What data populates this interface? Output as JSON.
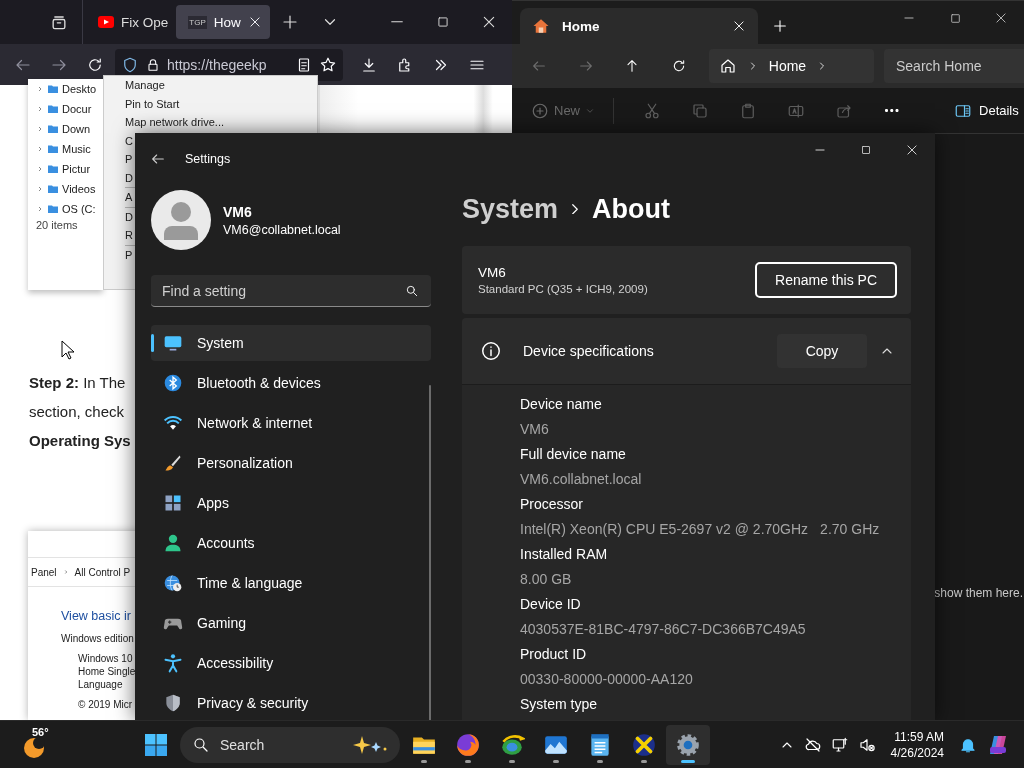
{
  "browser": {
    "tabs": [
      {
        "label": "Fix Ope",
        "selected": false
      },
      {
        "label": "How",
        "favicon_text": "TGP",
        "selected": true
      }
    ],
    "url": "https://thegeekp",
    "page": {
      "tree_items": [
        "Deskto",
        "Docur",
        "Down",
        "Music",
        "Pictur",
        "Videos",
        "OS (C:"
      ],
      "item_count": "20 items",
      "menu_items": [
        "Manage",
        "Pin to Start",
        "Map network drive...",
        "C",
        "P",
        "D",
        "A",
        "D",
        "R",
        "P"
      ],
      "step_lines": [
        {
          "text": "**Step 2:** In The",
          "bold": false
        },
        {
          "text": "section, check",
          "bold": false
        },
        {
          "text": "Operating Sys",
          "bold": true
        }
      ],
      "breadcrumb": [
        "Panel",
        "All Control P"
      ],
      "heading": "View basic ir",
      "edition_label": "Windows edition",
      "edition_lines": [
        "Windows 10",
        "Home Single",
        "Language"
      ],
      "copyright": "© 2019 Micr"
    }
  },
  "explorer": {
    "tabs": [
      {
        "label": "Home",
        "selected": true
      }
    ],
    "address": [
      "Home"
    ],
    "search": {
      "placeholder": "Search Home"
    },
    "new": {
      "label": "New",
      "disabled": true
    },
    "details": "Details",
    "content_text": "show them here."
  },
  "settings": {
    "title": "Settings",
    "user": {
      "name": "VM6",
      "email": "VM6@collabnet.local"
    },
    "search": {
      "placeholder": "Find a setting"
    },
    "nav": [
      {
        "label": "System",
        "kind": "system",
        "selected": true
      },
      {
        "label": "Bluetooth & devices",
        "kind": "bluetooth",
        "selected": false
      },
      {
        "label": "Network & internet",
        "kind": "network",
        "selected": false
      },
      {
        "label": "Personalization",
        "kind": "personalization",
        "selected": false
      },
      {
        "label": "Apps",
        "kind": "apps",
        "selected": false
      },
      {
        "label": "Accounts",
        "kind": "accounts",
        "selected": false
      },
      {
        "label": "Time & language",
        "kind": "time",
        "selected": false
      },
      {
        "label": "Gaming",
        "kind": "gaming",
        "selected": false
      },
      {
        "label": "Accessibility",
        "kind": "accessibility",
        "selected": false
      },
      {
        "label": "Privacy & security",
        "kind": "privacy",
        "selected": false
      }
    ],
    "breadcrumb": {
      "parent": "System",
      "current": "About"
    },
    "pc": {
      "name": "VM6",
      "model": "Standard PC (Q35 + ICH9, 2009)",
      "button": "Rename this PC"
    },
    "specs": {
      "title": "Device specifications",
      "copy": "Copy",
      "expanded": true,
      "items": [
        {
          "label": "Device name",
          "values": [
            "VM6"
          ]
        },
        {
          "label": "Full device name",
          "values": [
            "VM6.collabnet.local"
          ]
        },
        {
          "label": "Processor",
          "values": [
            "Intel(R) Xeon(R) CPU E5-2697 v2 @ 2.70GHz",
            "2.70 GHz"
          ]
        },
        {
          "label": "Installed RAM",
          "values": [
            "8.00 GB"
          ]
        },
        {
          "label": "Device ID",
          "values": [
            "4030537E-81BC-4797-86C7-DC366B7C49A5"
          ]
        },
        {
          "label": "Product ID",
          "values": [
            "00330-80000-00000-AA120"
          ]
        },
        {
          "label": "System type"
        }
      ]
    }
  },
  "taskbar": {
    "weather": "56°",
    "search": {
      "placeholder": "Search"
    },
    "apps": [
      {
        "kind": "files",
        "selected": false
      },
      {
        "kind": "firefox",
        "selected": false
      },
      {
        "kind": "globe",
        "selected": false
      },
      {
        "kind": "photos",
        "selected": false
      },
      {
        "kind": "notepad",
        "selected": false
      },
      {
        "kind": "xapp",
        "selected": false
      },
      {
        "kind": "settings",
        "selected": true
      }
    ],
    "time": "11:59 AM",
    "date": "4/26/2024"
  }
}
